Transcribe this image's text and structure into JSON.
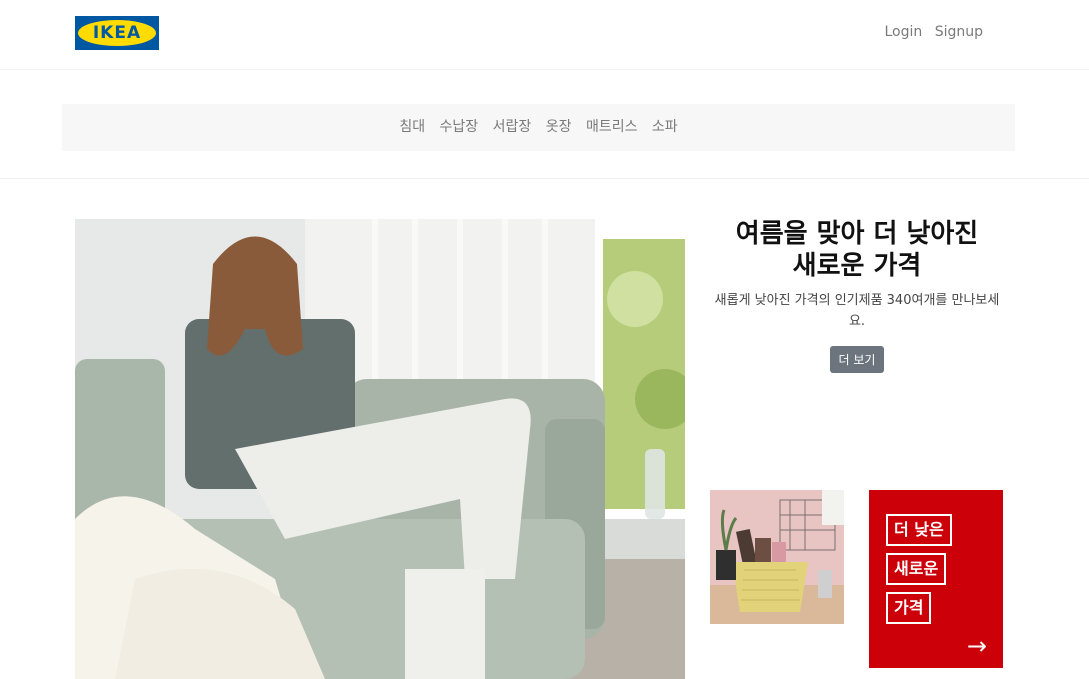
{
  "header": {
    "logo_text": "IKEA",
    "login_label": "Login",
    "signup_label": "Signup"
  },
  "categories": [
    "침대",
    "수납장",
    "서랍장",
    "옷장",
    "매트리스",
    "소파"
  ],
  "promo": {
    "title_line1": "여름을 맞아 더 낮아진",
    "title_line2": "새로운 가격",
    "subtitle": "새롭게 낮아진 가격의 인기제품 340여개를 만나보세요.",
    "button_label": "더 보기"
  },
  "red_card": {
    "tags": [
      "더 낮은",
      "새로운",
      "가격"
    ],
    "arrow_icon": "arrow-right-icon"
  },
  "colors": {
    "ikea_blue": "#0058a3",
    "ikea_yellow": "#ffdb00",
    "promo_red": "#cc0008",
    "button_gray": "#6c757d"
  }
}
